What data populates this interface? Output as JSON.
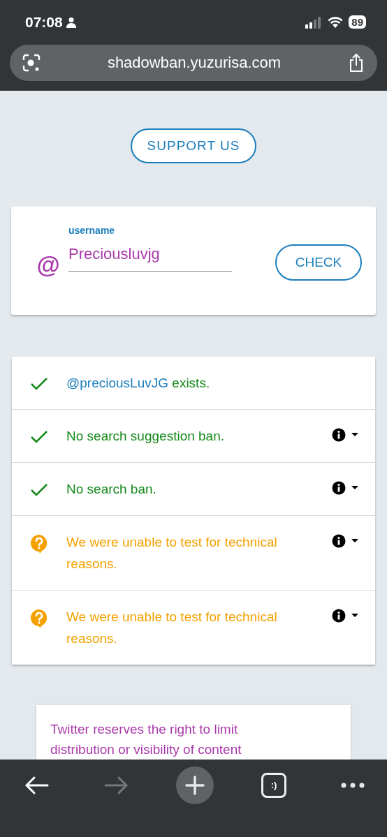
{
  "status_bar": {
    "time": "07:08",
    "battery": "89"
  },
  "address_bar": {
    "url": "shadowban.yuzurisa.com"
  },
  "support_button": {
    "label": "SUPPORT US"
  },
  "form": {
    "prefix": "@",
    "label": "username",
    "value": "Preciousluvjg",
    "button": "CHECK"
  },
  "results": [
    {
      "kind": "pass",
      "handle": "@preciousLuvJG",
      "text": " exists.",
      "has_info": false
    },
    {
      "kind": "pass",
      "text": "No search suggestion ban.",
      "has_info": true
    },
    {
      "kind": "pass",
      "text": "No search ban.",
      "has_info": true
    },
    {
      "kind": "unknown",
      "text": "We were unable to test for technical reasons.",
      "has_info": true
    },
    {
      "kind": "unknown",
      "text": "We were unable to test for technical reasons.",
      "has_info": true
    }
  ],
  "notice": {
    "text": "Twitter reserves the right to limit distribution or visibility of content"
  },
  "toolbar": {
    "forward_disabled": true,
    "tabs_label": ":)"
  }
}
